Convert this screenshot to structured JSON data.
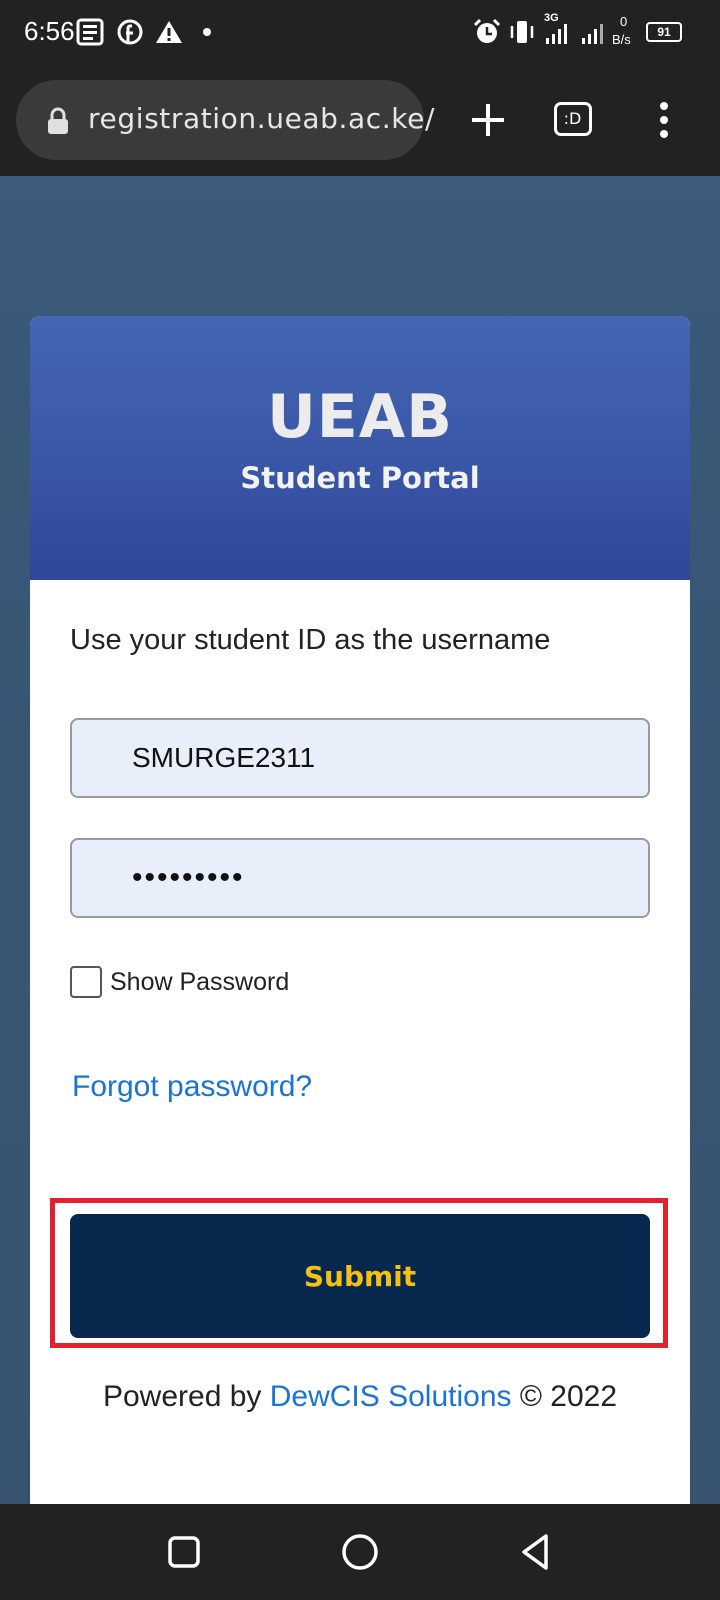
{
  "status_bar": {
    "time": "6:56",
    "network_speed_value": "0",
    "network_speed_unit": "B/s",
    "network_type": "3G",
    "battery": "91"
  },
  "browser": {
    "url": "registration.ueab.ac.ke/",
    "tab_icon_text": ":D"
  },
  "card": {
    "title": "UEAB",
    "subtitle": "Student Portal",
    "instruction": "Use your student ID as the username",
    "username_value": "SMURGE2311",
    "password_value": "•••••••••",
    "show_password_label": "Show Password",
    "forgot_link": "Forgot password?",
    "submit_label": "Submit"
  },
  "footer": {
    "prefix": "Powered by ",
    "link": "DewCIS Solutions",
    "suffix": " © 2022"
  },
  "colors": {
    "header_blue": "#3b58a8",
    "submit_bg": "#08284e",
    "submit_text": "#f3c013",
    "link": "#1a73d6",
    "highlight": "#e3202e",
    "input_bg": "#e8effb"
  }
}
